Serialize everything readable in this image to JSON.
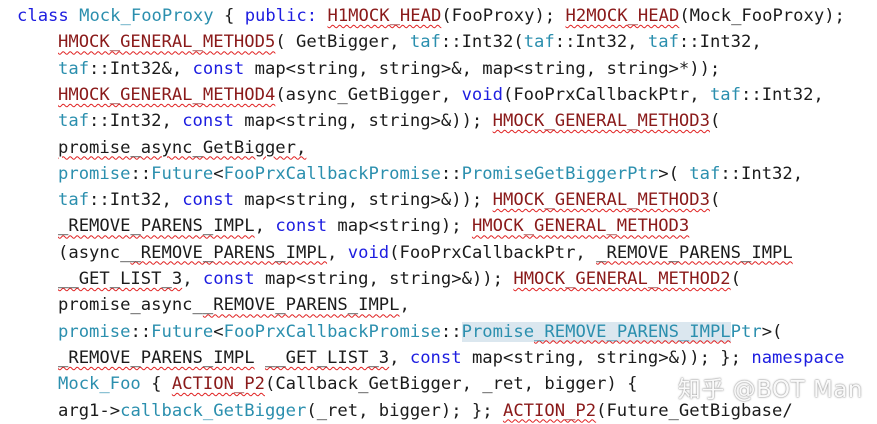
{
  "lines": [
    [
      {
        "t": "class",
        "c": "kw"
      },
      {
        "t": " "
      },
      {
        "t": "Mock_FooProxy",
        "c": "ty"
      },
      {
        "t": " { "
      },
      {
        "t": "public:",
        "c": "kw"
      },
      {
        "t": " "
      },
      {
        "t": "H1MOCK_HEAD",
        "c": "mac"
      },
      {
        "t": "(FooProxy); "
      },
      {
        "t": "H2MOCK_HEAD",
        "c": "mac"
      },
      {
        "t": "(Mock_FooProxy);"
      }
    ],
    [
      {
        "t": "HMOCK_GENERAL_METHOD5",
        "c": "mac"
      },
      {
        "t": "( GetBigger, "
      },
      {
        "t": "taf",
        "c": "ty"
      },
      {
        "t": "::Int32("
      },
      {
        "t": "taf",
        "c": "ty"
      },
      {
        "t": "::Int32, "
      },
      {
        "t": "taf",
        "c": "ty"
      },
      {
        "t": "::Int32,"
      }
    ],
    [
      {
        "t": "taf",
        "c": "ty"
      },
      {
        "t": "::Int32&, "
      },
      {
        "t": "const",
        "c": "kw"
      },
      {
        "t": " map<string, string>&, map<string, string>*));"
      }
    ],
    [
      {
        "t": "HMOCK_GENERAL_METHOD4",
        "c": "mac"
      },
      {
        "t": "(async_GetBigger, "
      },
      {
        "t": "void",
        "c": "kw"
      },
      {
        "t": "(FooPrxCallbackPtr, "
      },
      {
        "t": "taf",
        "c": "ty"
      },
      {
        "t": "::Int32,"
      }
    ],
    [
      {
        "t": "taf",
        "c": "ty"
      },
      {
        "t": "::Int32, "
      },
      {
        "t": "const",
        "c": "kw"
      },
      {
        "t": " map<string, string>&)); "
      },
      {
        "t": "HMOCK_GENERAL_METHOD3",
        "c": "mac"
      },
      {
        "t": "("
      }
    ],
    [
      {
        "t": "promise_async_GetBigger,",
        "c": "sq"
      }
    ],
    [
      {
        "t": "promise",
        "c": "ty"
      },
      {
        "t": "::"
      },
      {
        "t": "Future",
        "c": "ty"
      },
      {
        "t": "<"
      },
      {
        "t": "FooPrxCallbackPromise",
        "c": "ty"
      },
      {
        "t": "::"
      },
      {
        "t": "PromiseGetBiggerPtr",
        "c": "ty"
      },
      {
        "t": ">( "
      },
      {
        "t": "taf",
        "c": "ty"
      },
      {
        "t": "::Int32,"
      }
    ],
    [
      {
        "t": "taf",
        "c": "ty"
      },
      {
        "t": "::Int32, "
      },
      {
        "t": "const",
        "c": "kw"
      },
      {
        "t": " map<string, string>&)); "
      },
      {
        "t": "HMOCK_GENERAL_METHOD3",
        "c": "mac"
      },
      {
        "t": "("
      }
    ],
    [
      {
        "t": "_REMOVE_PARENS_IMPL",
        "c": "sq"
      },
      {
        "t": ", "
      },
      {
        "t": "const",
        "c": "kw"
      },
      {
        "t": " map<string); "
      },
      {
        "t": "HMOCK_GENERAL_METHOD3",
        "c": "mac"
      }
    ],
    [
      {
        "t": "(async_"
      },
      {
        "t": "_REMOVE_PARENS_IMPL",
        "c": "sq"
      },
      {
        "t": ", "
      },
      {
        "t": "void",
        "c": "kw"
      },
      {
        "t": "(FooPrxCallbackPtr, "
      },
      {
        "t": "_REMOVE_PARENS_IMPL",
        "c": "sq"
      }
    ],
    [
      {
        "t": "__GET_LIST_3",
        "c": "sq"
      },
      {
        "t": ", "
      },
      {
        "t": "const",
        "c": "kw"
      },
      {
        "t": " map<string, string>&)); "
      },
      {
        "t": "HMOCK_GENERAL_METHOD2",
        "c": "mac"
      },
      {
        "t": "("
      }
    ],
    [
      {
        "t": "promise_async_"
      },
      {
        "t": "_REMOVE_PARENS_IMPL",
        "c": "sq"
      },
      {
        "t": ","
      }
    ],
    [
      {
        "t": "promise",
        "c": "ty"
      },
      {
        "t": "::"
      },
      {
        "t": "Future",
        "c": "ty"
      },
      {
        "t": "<"
      },
      {
        "t": "FooPrxCallbackPromise",
        "c": "ty"
      },
      {
        "t": "::"
      },
      {
        "t": "Promise",
        "c": "ty hl"
      },
      {
        "t": "_REMOVE_PARENS_IMPL",
        "c": "ty hl sq"
      },
      {
        "t": "Ptr",
        "c": "ty"
      },
      {
        "t": ">("
      }
    ],
    [
      {
        "t": "_REMOVE_PARENS_IMPL",
        "c": "sq"
      },
      {
        "t": " "
      },
      {
        "t": "__GET_LIST_3",
        "c": "sq"
      },
      {
        "t": ", "
      },
      {
        "t": "const",
        "c": "kw"
      },
      {
        "t": " map<string, string>&)); }; "
      },
      {
        "t": "namespace",
        "c": "kw"
      }
    ],
    [
      {
        "t": "Mock_Foo",
        "c": "ty"
      },
      {
        "t": " { "
      },
      {
        "t": "ACTION_P2",
        "c": "mac"
      },
      {
        "t": "(Callback_GetBigger, _ret, bigger) {"
      }
    ],
    [
      {
        "t": "arg1->"
      },
      {
        "t": "callback_GetBigger",
        "c": "ty"
      },
      {
        "t": "(_ret, bigger); }; "
      },
      {
        "t": "ACTION_P2",
        "c": "mac"
      },
      {
        "t": "(Future_GetBigbase/"
      }
    ]
  ],
  "watermark": "知乎 @BOT Man"
}
